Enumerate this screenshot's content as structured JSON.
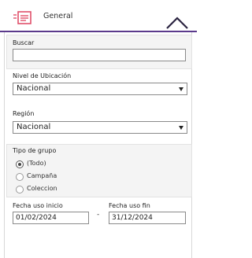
{
  "header": {
    "title": "General"
  },
  "search": {
    "label": "Buscar",
    "value": ""
  },
  "ubicacion": {
    "label": "Nivel de Ubicación",
    "selected": "Nacional"
  },
  "region": {
    "label": "Región",
    "selected": "Nacional"
  },
  "tipo_grupo": {
    "label": "Tipo de grupo",
    "options": [
      "(Todo)",
      "Campaña",
      "Coleccion"
    ],
    "selected_index": 0
  },
  "fecha_inicio": {
    "label": "Fecha uso inicio",
    "value": "01/02/2024"
  },
  "separator": "-",
  "fecha_fin": {
    "label": "Fecha uso fin",
    "value": "31/12/2024"
  },
  "colors": {
    "accent": "#5b3a8c",
    "logo": "#e0506a"
  }
}
